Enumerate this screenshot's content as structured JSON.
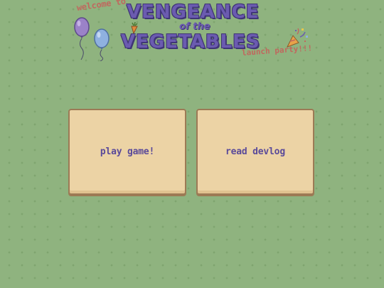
{
  "header": {
    "welcome_text": "welcome to",
    "title_line1": "VENGEANCE",
    "title_of": "of the",
    "title_line2": "VEGETABLES",
    "subtitle": "launch party!!!"
  },
  "buttons": {
    "play_label": "play game!",
    "devlog_label": "read devlog"
  },
  "colors": {
    "background": "#8fb37f",
    "title": "#6b5bb0",
    "accent_text": "#c0685e",
    "button_face": "#ecd3a5",
    "button_border": "#9c7a55",
    "balloon_purple": "#9b82c8",
    "balloon_blue": "#8fb1e0"
  },
  "icons": [
    "balloon-purple-icon",
    "balloon-blue-icon",
    "carrot-icon",
    "party-popper-icon"
  ]
}
